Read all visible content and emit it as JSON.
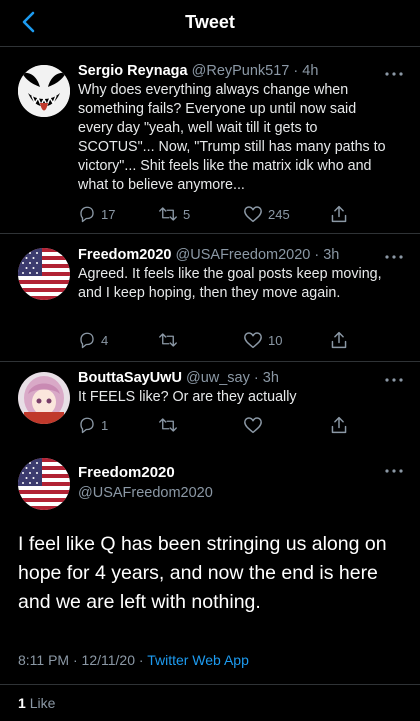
{
  "header": {
    "title": "Tweet"
  },
  "replies": [
    {
      "name": "Sergio Reynaga",
      "handle": "@ReyPunk517",
      "time": "4h",
      "text": "Why does everything always change when something fails? Everyone up until now said every day \"yeah, well wait till it gets to SCOTUS\"... Now, \"Trump still has many paths to victory\"... Shit feels like the matrix idk who and what to believe anymore...",
      "reply_count": "17",
      "retweet_count": "5",
      "like_count": "245"
    },
    {
      "name": "Freedom2020",
      "handle": "@USAFreedom2020",
      "time": "3h",
      "text": "Agreed.  It feels like the goal posts keep moving, and I keep hoping, then they move again.",
      "reply_count": "4",
      "retweet_count": "",
      "like_count": "10"
    },
    {
      "name": "BouttaSayUwU",
      "handle": "@uw_say",
      "time": "3h",
      "text": "It FEELS like? Or are they actually",
      "reply_count": "1",
      "retweet_count": "",
      "like_count": ""
    }
  ],
  "main_tweet": {
    "name": "Freedom2020",
    "handle": "@USAFreedom2020",
    "text": "I feel like Q has been stringing us along on hope for 4 years, and now the end is here and we are left with nothing.",
    "timestamp": "8:11 PM · 12/11/20 · ",
    "source": "Twitter Web App",
    "like_count": "1",
    "like_label": "Like"
  },
  "colors": {
    "accent": "#1d9bf0",
    "muted": "#8b98a5",
    "background": "#000000"
  },
  "icons": [
    "back-arrow-icon",
    "more-icon",
    "reply-icon",
    "retweet-icon",
    "like-icon",
    "share-icon"
  ]
}
